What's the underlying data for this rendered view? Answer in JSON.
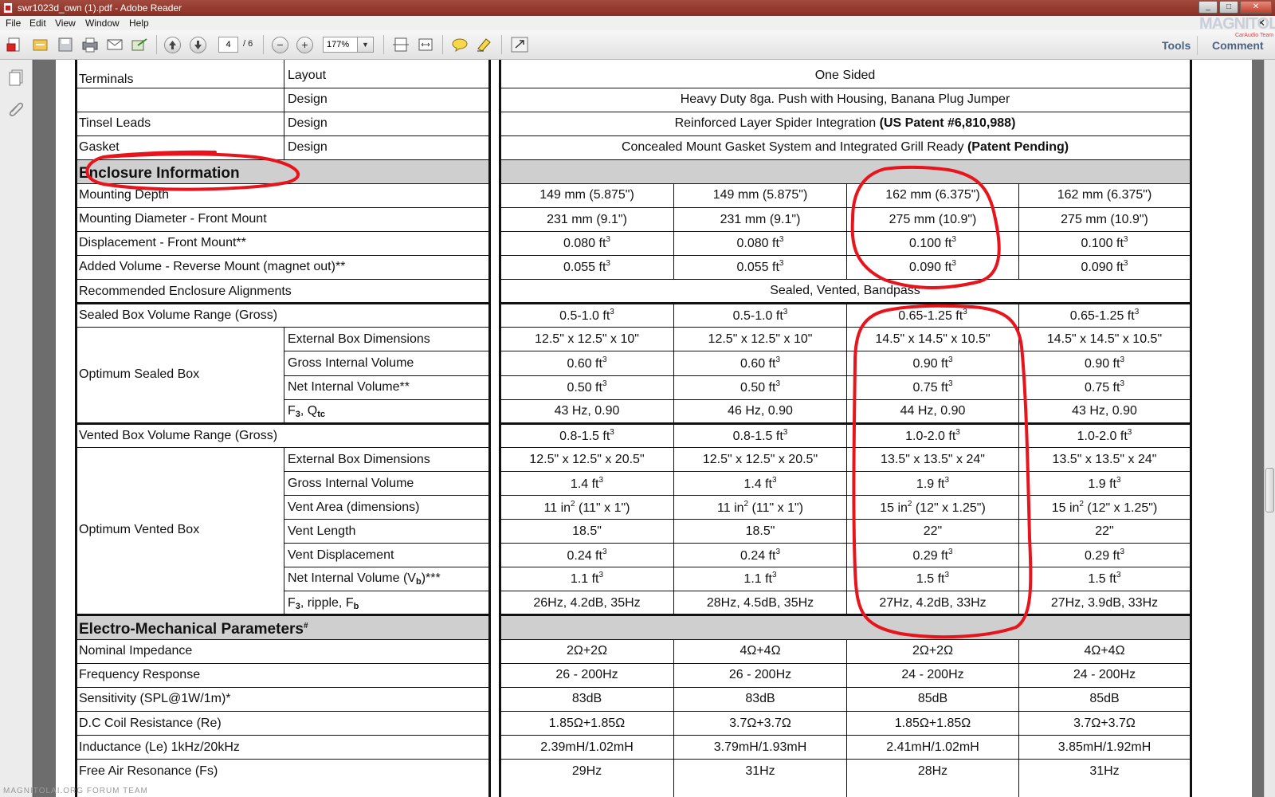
{
  "window": {
    "title": "swr1023d_own (1).pdf - Adobe Reader",
    "minimize": "_",
    "maximize": "□",
    "close": "✕"
  },
  "menu": {
    "file": "File",
    "edit": "Edit",
    "view": "View",
    "window": "Window",
    "help": "Help",
    "doc_close": "✕"
  },
  "toolbar": {
    "page_current": "4",
    "page_total": "/ 6",
    "zoom": "177%",
    "zoom_out": "−",
    "zoom_in": "+",
    "tools": "Tools",
    "comment": "Comment"
  },
  "branding": {
    "watermark": "MAGNITOLA",
    "watermark_sub": "CarAudio Team",
    "bottom_mark": "MAGNITOLAI.ORG FORUM TEAM"
  },
  "table": {
    "terminals": {
      "label": "Terminals",
      "layout": "Layout",
      "layout_value": "One Sided",
      "design": "Design",
      "design_value": "Heavy Duty 8ga. Push with Housing, Banana Plug Jumper"
    },
    "tinsel": {
      "label": "Tinsel Leads",
      "design": "Design",
      "value": "Reinforced Layer Spider Integration",
      "value_bold": "(US Patent #6,810,988)"
    },
    "gasket": {
      "label": "Gasket",
      "design": "Design",
      "value": "Concealed Mount Gasket System and Integrated Grill Ready",
      "value_bold": "(Patent Pending)"
    },
    "enclosure_header": "Enclosure Information",
    "enclosure_rows": [
      {
        "label": "Mounting Depth",
        "values": [
          "149 mm (5.875\")",
          "149 mm (5.875\")",
          "162 mm (6.375\")",
          "162 mm (6.375\")"
        ]
      },
      {
        "label": "Mounting Diameter - Front Mount",
        "values": [
          "231 mm (9.1\")",
          "231 mm (9.1\")",
          "275 mm (10.9\")",
          "275 mm (10.9\")"
        ]
      },
      {
        "label": "Displacement - Front Mount**",
        "values": [
          "0.080 ft",
          "0.080 ft",
          "0.100 ft",
          "0.100 ft"
        ]
      },
      {
        "label": "Added Volume - Reverse Mount (magnet out)**",
        "values": [
          "0.055 ft",
          "0.055 ft",
          "0.090 ft",
          "0.090 ft"
        ]
      }
    ],
    "alignments": {
      "label": "Recommended Enclosure Alignments",
      "value": "Sealed, Vented, Bandpass"
    },
    "sealed_range": {
      "label": "Sealed Box Volume Range (Gross)",
      "values": [
        "0.5-1.0 ft",
        "0.5-1.0 ft",
        "0.65-1.25 ft",
        "0.65-1.25 ft"
      ]
    },
    "sealed_group": "Optimum Sealed Box",
    "sealed_rows": [
      {
        "label": "External Box Dimensions",
        "values": [
          "12.5\" x 12.5\" x 10\"",
          "12.5\" x 12.5\" x 10\"",
          "14.5\" x 14.5\" x 10.5\"",
          "14.5\" x 14.5\" x 10.5\""
        ]
      },
      {
        "label": "Gross Internal Volume",
        "values": [
          "0.60 ft",
          "0.60 ft",
          "0.90 ft",
          "0.90 ft"
        ]
      },
      {
        "label": "Net Internal Volume**",
        "values": [
          "0.50 ft",
          "0.50 ft",
          "0.75 ft",
          "0.75 ft"
        ]
      },
      {
        "label_main": "F",
        "label_sub1": "3",
        "label_mid": ", Q",
        "label_sub2": "tc",
        "values": [
          "43 Hz, 0.90",
          "46 Hz, 0.90",
          "44 Hz, 0.90",
          "43 Hz, 0.90"
        ]
      }
    ],
    "vented_range": {
      "label": "Vented Box Volume Range (Gross)",
      "values": [
        "0.8-1.5 ft",
        "0.8-1.5 ft",
        "1.0-2.0 ft",
        "1.0-2.0 ft"
      ]
    },
    "vented_group": "Optimum Vented Box",
    "vented_rows": [
      {
        "label": "External Box Dimensions",
        "values": [
          "12.5\" x 12.5\" x 20.5\"",
          "12.5\" x 12.5\" x 20.5\"",
          "13.5\" x 13.5\" x 24\"",
          "13.5\" x 13.5\" x 24\""
        ]
      },
      {
        "label": "Gross Internal Volume",
        "values": [
          "1.4 ft",
          "1.4 ft",
          "1.9 ft",
          "1.9 ft"
        ]
      },
      {
        "label": "Vent Area (dimensions)",
        "values_pre": [
          "11 in",
          "11 in",
          "15 in",
          "15 in"
        ],
        "values_post": [
          " (11\" x 1\")",
          " (11\" x 1\")",
          " (12\" x 1.25\")",
          " (12\" x 1.25\")"
        ]
      },
      {
        "label": "Vent Length",
        "values": [
          "18.5\"",
          "18.5\"",
          "22\"",
          "22\""
        ]
      },
      {
        "label": "Vent Displacement",
        "values": [
          "0.24 ft",
          "0.24 ft",
          "0.29 ft",
          "0.29 ft"
        ]
      },
      {
        "label_pre": "Net Internal Volume (V",
        "label_sub": "b",
        "label_post": ")***",
        "values": [
          "1.1 ft",
          "1.1 ft",
          "1.5 ft",
          "1.5 ft"
        ]
      },
      {
        "label_pre": "F",
        "label_sub1": "3",
        "label_mid": ", ripple, F",
        "label_sub2": "b",
        "values": [
          "26Hz, 4.2dB, 35Hz",
          "28Hz, 4.5dB, 35Hz",
          "27Hz, 4.2dB, 33Hz",
          "27Hz, 3.9dB, 33Hz"
        ]
      }
    ],
    "electro_header": "Electro-Mechanical Parameters",
    "electro_header_mark": "#",
    "electro_rows": [
      {
        "label": "Nominal Impedance",
        "values": [
          "2Ω+2Ω",
          "4Ω+4Ω",
          "2Ω+2Ω",
          "4Ω+4Ω"
        ]
      },
      {
        "label": "Frequency Response",
        "values": [
          "26 - 200Hz",
          "26 - 200Hz",
          "24 - 200Hz",
          "24 - 200Hz"
        ]
      },
      {
        "label": "Sensitivity (SPL@1W/1m)*",
        "values": [
          "83dB",
          "83dB",
          "85dB",
          "85dB"
        ]
      },
      {
        "label": "D.C Coil Resistance (Re)",
        "values": [
          "1.85Ω+1.85Ω",
          "3.7Ω+3.7Ω",
          "1.85Ω+1.85Ω",
          "3.7Ω+3.7Ω"
        ]
      },
      {
        "label": "Inductance (Le) 1kHz/20kHz",
        "values": [
          "2.39mH/1.02mH",
          "3.79mH/1.93mH",
          "2.41mH/1.02mH",
          "3.85mH/1.92mH"
        ]
      },
      {
        "label": "Free Air Resonance (Fs)",
        "values": [
          "29Hz",
          "31Hz",
          "28Hz",
          "31Hz"
        ]
      }
    ],
    "cube": "3",
    "square": "2"
  },
  "colors": {
    "annotation": "#e8141c",
    "titlebar": "#97392e",
    "header_gray": "#cfcfcf",
    "link_blue": "#4a6584"
  }
}
